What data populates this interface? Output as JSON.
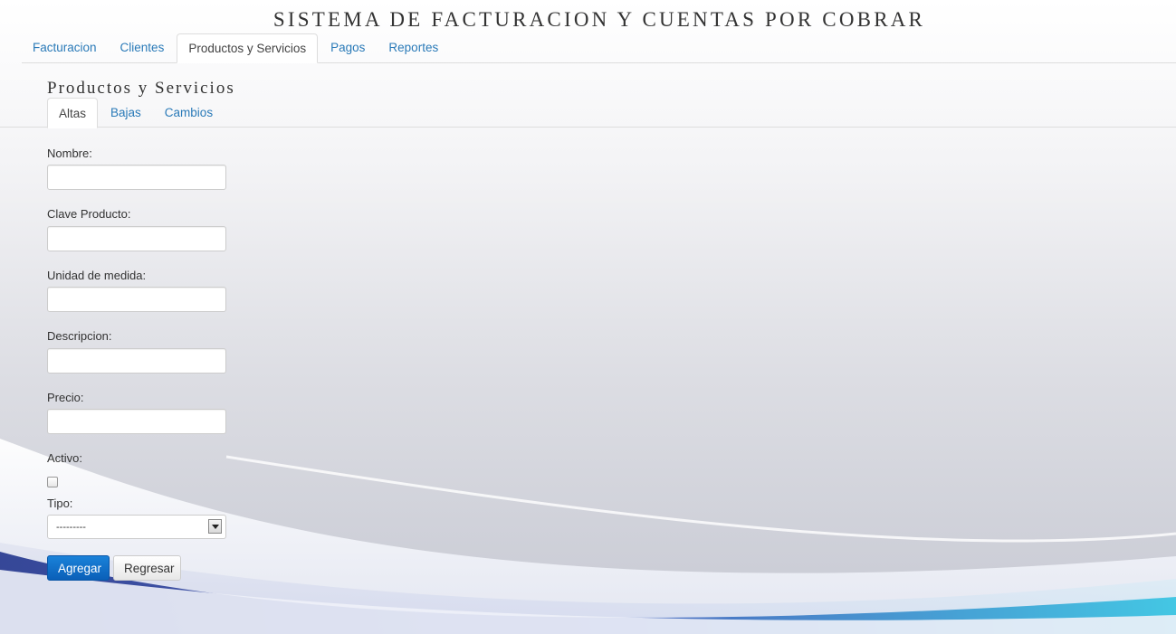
{
  "app": {
    "title": "SISTEMA DE FACTURACION Y CUENTAS POR COBRAR"
  },
  "nav": {
    "tabs": [
      {
        "label": "Facturacion"
      },
      {
        "label": "Clientes"
      },
      {
        "label": "Productos y Servicios",
        "active": true
      },
      {
        "label": "Pagos"
      },
      {
        "label": "Reportes"
      }
    ]
  },
  "section": {
    "title": "Productos y Servicios",
    "tabs": [
      {
        "label": "Altas",
        "active": true
      },
      {
        "label": "Bajas"
      },
      {
        "label": "Cambios"
      }
    ]
  },
  "form": {
    "nombre": {
      "label": "Nombre:",
      "value": ""
    },
    "clave": {
      "label": "Clave Producto:",
      "value": ""
    },
    "unidad": {
      "label": "Unidad de medida:",
      "value": ""
    },
    "descripcion": {
      "label": "Descripcion:",
      "value": ""
    },
    "precio": {
      "label": "Precio:",
      "value": ""
    },
    "activo": {
      "label": "Activo:",
      "checked": false
    },
    "tipo": {
      "label": "Tipo:",
      "selected": "---------"
    },
    "submit_label": "Agregar",
    "back_label": "Regresar"
  },
  "colors": {
    "link": "#2a7ab8",
    "primary_button": "#0a5fb8",
    "background_wave": "#1a3f9a"
  }
}
